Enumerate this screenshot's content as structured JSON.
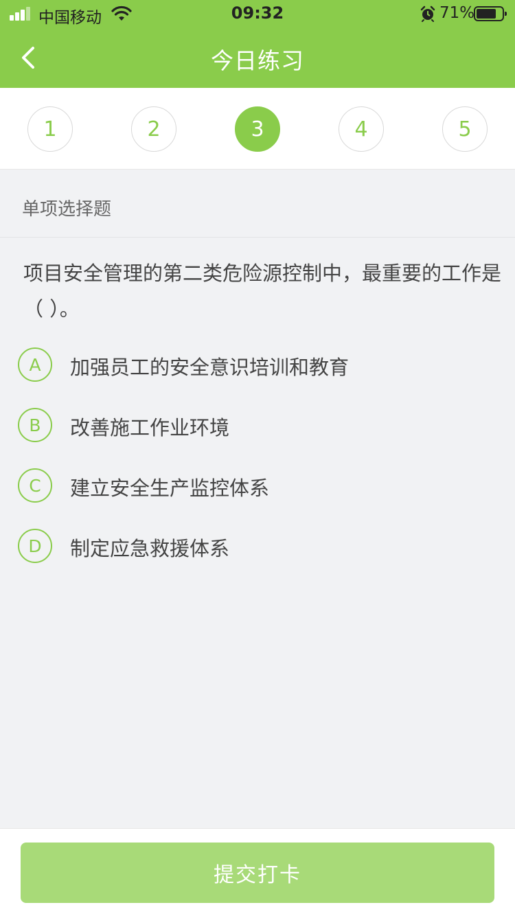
{
  "status_bar": {
    "carrier": "中国移动",
    "time": "09:32",
    "battery_percent": "71%",
    "battery_level": 0.71,
    "icons": [
      "signal-icon",
      "wifi-icon",
      "alarm-icon",
      "battery-icon"
    ]
  },
  "nav": {
    "title": "今日练习",
    "back_icon": "chevron-left-icon"
  },
  "question_numbers": {
    "items": [
      "1",
      "2",
      "3",
      "4",
      "5"
    ],
    "active": "3"
  },
  "question": {
    "type": "单项选择题",
    "text": "项目安全管理的第二类危险源控制中，最重要的工作是（    ）。",
    "options": [
      {
        "key": "A",
        "text": "加强员工的安全意识培训和教育"
      },
      {
        "key": "B",
        "text": "改善施工作业环境"
      },
      {
        "key": "C",
        "text": "建立安全生产监控体系"
      },
      {
        "key": "D",
        "text": "制定应急救援体系"
      }
    ]
  },
  "footer": {
    "submit_label": "提交打卡"
  },
  "colors": {
    "primary": "#8acc4b",
    "primary_disabled": "#a8da78",
    "background": "#f1f2f4",
    "text": "#444444"
  }
}
